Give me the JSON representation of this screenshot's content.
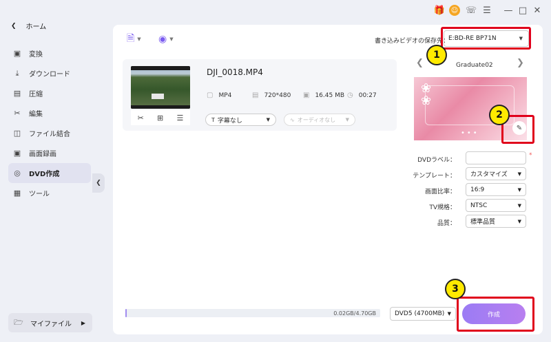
{
  "sidebar": {
    "home_label": "ホーム",
    "items": [
      {
        "label": "変換",
        "icon": "convert-icon"
      },
      {
        "label": "ダウンロード",
        "icon": "download-icon"
      },
      {
        "label": "圧縮",
        "icon": "compress-icon"
      },
      {
        "label": "編集",
        "icon": "edit-scissors-icon"
      },
      {
        "label": "ファイル結合",
        "icon": "merge-icon"
      },
      {
        "label": "画面録画",
        "icon": "record-icon"
      },
      {
        "label": "DVD作成",
        "icon": "dvd-icon",
        "active": true
      },
      {
        "label": "ツール",
        "icon": "tools-icon"
      }
    ],
    "my_files_label": "マイファイル"
  },
  "toolbar": {
    "add_file_icon": "add-file-icon",
    "add_disc_icon": "add-disc-icon",
    "save_to_label": "書き込みビデオの保存先：",
    "save_to_value": "E:BD-RE BP71N"
  },
  "video": {
    "name": "DJI_0018.MP4",
    "format": "MP4",
    "resolution": "720*480",
    "size": "16.45 MB",
    "duration": "00:27",
    "subtitle": "字幕なし",
    "audio": "オーディオなし"
  },
  "template": {
    "name": "Graduate02"
  },
  "settings": {
    "dvd_label": "DVDラベル：",
    "template_label": "テンプレート：",
    "template_value": "カスタマイズ",
    "aspect_label": "画面比率：",
    "aspect_value": "16:9",
    "tv_label": "TV規格：",
    "tv_value": "NTSC",
    "quality_label": "品質：",
    "quality_value": "標準品質"
  },
  "footer": {
    "capacity": "0.02GB/4.70GB",
    "disc_type": "DVD5 (4700MB)",
    "create_label": "作成",
    "progress_fraction": 0.004
  },
  "annotations": {
    "one": "1",
    "two": "2",
    "three": "3"
  }
}
